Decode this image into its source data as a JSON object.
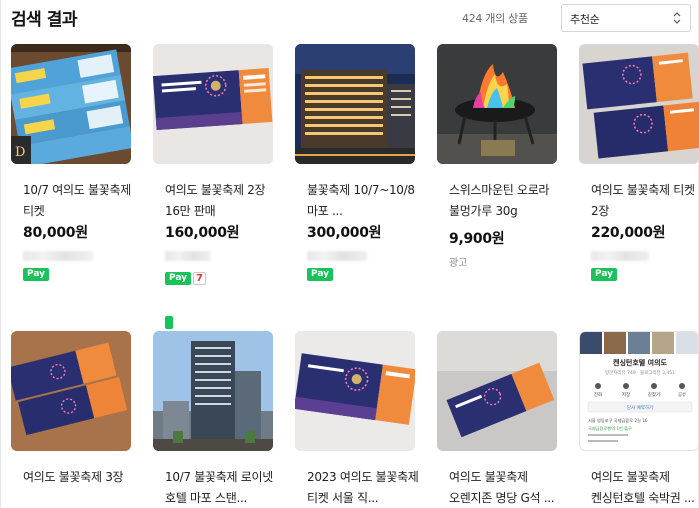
{
  "header": {
    "title": "검색 결과",
    "result_count": "424 개의 상품",
    "sort": {
      "selected": "추천순"
    }
  },
  "products": [
    {
      "title": "10/7 여의도 불꽃축제 티켓",
      "price": "80,000원",
      "badges": [
        "Pay"
      ],
      "thumbnail": "tickets-on-table"
    },
    {
      "title": "여의도 불꽃축제 2장 16만 판매",
      "price": "160,000원",
      "badges": [
        "Pay",
        "7"
      ],
      "thumbnail": "festival-ticket"
    },
    {
      "title": "불꽃축제 10/7~10/8 마포 ...",
      "price": "300,000원",
      "badges": [
        "Pay"
      ],
      "thumbnail": "hotel-night"
    },
    {
      "title": "스위스마운틴 오로라 불멍가루 30g",
      "price": "9,900원",
      "ad_label": "광고",
      "thumbnail": "campfire"
    },
    {
      "title": "여의도 불꽃축제 티켓 2장",
      "price": "220,000원",
      "badges": [
        "Pay"
      ],
      "thumbnail": "ticket-pair"
    },
    {
      "title": "여의도 불꽃축제 3장",
      "thumbnail": "tickets-on-wood"
    },
    {
      "title": "10/7 불꽃축제 로이넷 호텔 마포 스탠...",
      "thumbnail": "hotel-tower"
    },
    {
      "title": "2023 여의도 불꽃축제 티켓 서울 직...",
      "thumbnail": "ticket-angled"
    },
    {
      "title": "여의도 불꽃축제 오렌지존 명당 G석 ...",
      "thumbnail": "ticket-on-floor"
    },
    {
      "title": "여의도 불꽃축제 켄싱턴호텔 숙박권 ...",
      "thumbnail": "map-screenshot"
    }
  ],
  "thumbnail_text": {
    "map_title": "켄싱턴호텔 여의도",
    "map_subtitle": "방문자리뷰 749 · 블로그리뷰 3,451",
    "map_actions": [
      "전화",
      "저장",
      "길찾기",
      "공유"
    ],
    "map_notice": "당사 예약하기",
    "map_address": "서울 영등포구 국제금융로 2길 16",
    "map_station": "국제금융로행역 1번 출구"
  },
  "colors": {
    "pay_badge": "#19c25a",
    "ticket_navy": "#2a2f72",
    "ticket_orange": "#f08a3c"
  }
}
